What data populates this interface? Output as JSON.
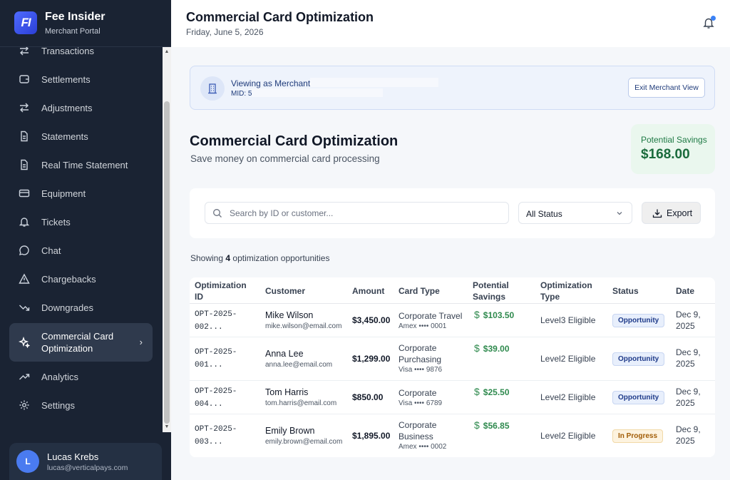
{
  "brand": {
    "logo": "FI",
    "name": "Fee Insider",
    "subtitle": "Merchant Portal"
  },
  "sidebar": {
    "items": [
      {
        "label": "Transactions",
        "icon": "arrows-swap-icon"
      },
      {
        "label": "Settlements",
        "icon": "wallet-icon"
      },
      {
        "label": "Adjustments",
        "icon": "arrows-swap-icon"
      },
      {
        "label": "Statements",
        "icon": "document-icon"
      },
      {
        "label": "Real Time Statement",
        "icon": "document-icon"
      },
      {
        "label": "Equipment",
        "icon": "card-terminal-icon"
      },
      {
        "label": "Tickets",
        "icon": "bell-icon"
      },
      {
        "label": "Chat",
        "icon": "chat-bubble-icon"
      },
      {
        "label": "Chargebacks",
        "icon": "warning-triangle-icon"
      },
      {
        "label": "Downgrades",
        "icon": "trend-down-icon"
      },
      {
        "label": "Commercial Card Optimization",
        "icon": "sparkle-icon",
        "active": true
      },
      {
        "label": "Analytics",
        "icon": "trend-up-icon"
      },
      {
        "label": "Settings",
        "icon": "gear-icon"
      }
    ],
    "chevron": "›"
  },
  "user": {
    "initial": "L",
    "name": "Lucas Krebs",
    "email": "lucas@verticalpays.com"
  },
  "header": {
    "title": "Commercial Card Optimization",
    "date": "Friday, June 5, 2026"
  },
  "banner": {
    "title": "Viewing as Merchant",
    "mid": "MID: 5",
    "exit_label": "Exit Merchant View"
  },
  "section": {
    "title": "Commercial Card Optimization",
    "subtitle": "Save money on commercial card processing",
    "savings_label": "Potential Savings",
    "savings_value": "$168.00"
  },
  "filters": {
    "search_placeholder": "Search by ID or customer...",
    "status_value": "All Status",
    "export_label": "Export"
  },
  "showing": {
    "prefix": "Showing",
    "count": "4",
    "suffix": "optimization opportunities"
  },
  "table": {
    "headers": {
      "id": "Optimization ID",
      "customer": "Customer",
      "amount": "Amount",
      "card_type": "Card Type",
      "savings": "Potential Savings",
      "opt_type": "Optimization Type",
      "status": "Status",
      "date": "Date"
    },
    "rows": [
      {
        "id": "OPT-2025-002...",
        "name": "Mike Wilson",
        "email": "mike.wilson@email.com",
        "amount": "$3,450.00",
        "card_type": "Corporate Travel",
        "card": "Amex •••• 0001",
        "savings": "$103.50",
        "opt_type": "Level3 Eligible",
        "status": "Opportunity",
        "status_kind": "opp",
        "date": "Dec 9, 2025"
      },
      {
        "id": "OPT-2025-001...",
        "name": "Anna Lee",
        "email": "anna.lee@email.com",
        "amount": "$1,299.00",
        "card_type": "Corporate Purchasing",
        "card": "Visa •••• 9876",
        "savings": "$39.00",
        "opt_type": "Level2 Eligible",
        "status": "Opportunity",
        "status_kind": "opp",
        "date": "Dec 9, 2025"
      },
      {
        "id": "OPT-2025-004...",
        "name": "Tom Harris",
        "email": "tom.harris@email.com",
        "amount": "$850.00",
        "card_type": "Corporate",
        "card": "Visa •••• 6789",
        "savings": "$25.50",
        "opt_type": "Level2 Eligible",
        "status": "Opportunity",
        "status_kind": "opp",
        "date": "Dec 9, 2025"
      },
      {
        "id": "OPT-2025-003...",
        "name": "Emily Brown",
        "email": "emily.brown@email.com",
        "amount": "$1,895.00",
        "card_type": "Corporate Business",
        "card": "Amex •••• 0002",
        "savings": "$56.85",
        "opt_type": "Level2 Eligible",
        "status": "In Progress",
        "status_kind": "prog",
        "date": "Dec 9, 2025"
      }
    ]
  },
  "colors": {
    "sidebar_bg": "#1a2333",
    "accent": "#3b82f6",
    "savings_green": "#2f8a4e",
    "badge_progress": "#a15c06"
  }
}
